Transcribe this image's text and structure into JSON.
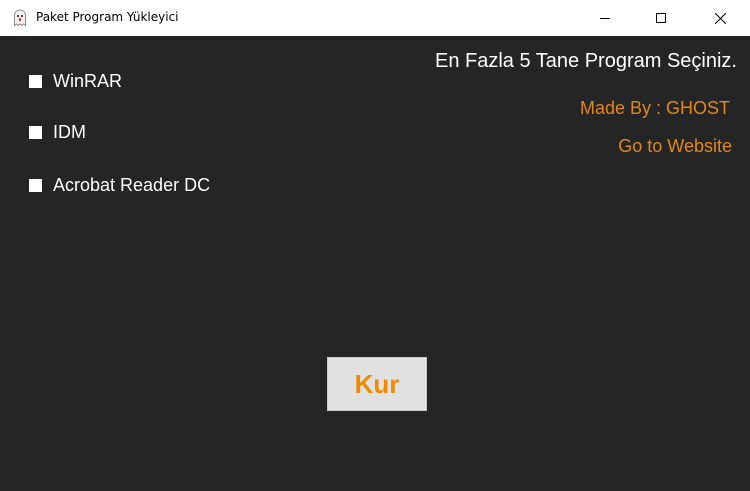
{
  "window": {
    "title": "Paket Program Yükleyici",
    "app_icon": "ghost-icon",
    "controls": {
      "minimize_icon": "minimize-icon",
      "maximize_icon": "maximize-icon",
      "close_icon": "close-icon"
    }
  },
  "programs": [
    {
      "label": "WinRAR",
      "checked": false
    },
    {
      "label": "IDM",
      "checked": false
    },
    {
      "label": "Acrobat Reader DC",
      "checked": false
    }
  ],
  "header": {
    "instruction": "En Fazla 5 Tane Program Seçiniz."
  },
  "credits": {
    "made_by": "Made By : GHOST",
    "website_link": "Go to Website"
  },
  "install_button": {
    "label": "Kur"
  },
  "colors": {
    "background": "#252525",
    "accent": "#e0881c",
    "button_text": "#f28a00",
    "button_bg": "#e1e1e1"
  }
}
